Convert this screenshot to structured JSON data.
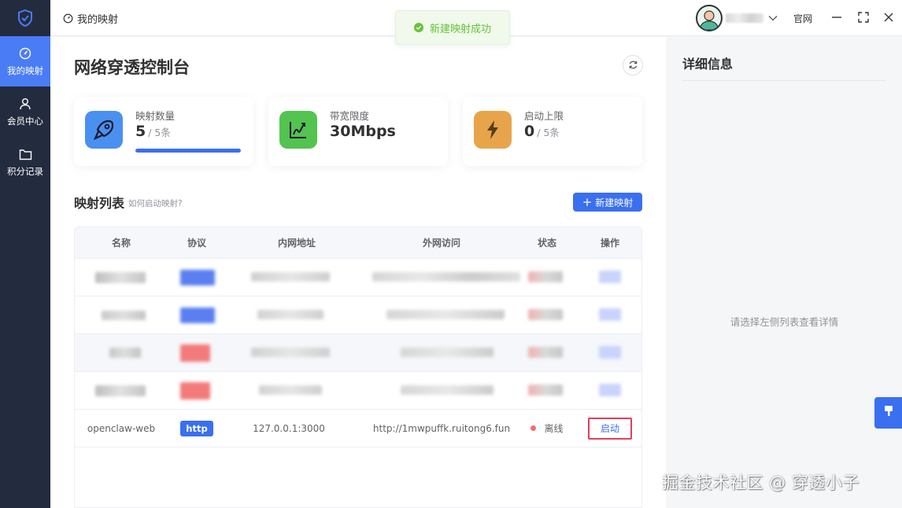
{
  "sidebar": {
    "items": [
      {
        "label": "我的映射",
        "icon": "gauge-icon",
        "active": true
      },
      {
        "label": "会员中心",
        "icon": "user-icon",
        "active": false
      },
      {
        "label": "积分记录",
        "icon": "folder-icon",
        "active": false
      }
    ]
  },
  "topbar": {
    "breadcrumb": "我的映射",
    "official_label": "官网"
  },
  "toast": {
    "text": "新建映射成功"
  },
  "main": {
    "title": "网络穿透控制台",
    "stats": [
      {
        "label": "映射数量",
        "value": "5",
        "sub": "/ 5条",
        "progress": 1.0,
        "color": "#4a90f0"
      },
      {
        "label": "带宽限度",
        "value": "30Mbps",
        "sub": "",
        "color": "#52c44f"
      },
      {
        "label": "启动上限",
        "value": "0",
        "sub": "/ 5条",
        "color": "#e8a44a"
      }
    ],
    "list_title": "映射列表",
    "list_help": "如何启动映射?",
    "new_button": "新建映射"
  },
  "table": {
    "headers": [
      "名称",
      "协议",
      "内网地址",
      "外网访问",
      "状态",
      "操作"
    ],
    "visible_row": {
      "name": "openclaw-web",
      "protocol": "http",
      "local": "127.0.0.1:3000",
      "remote": "http://1mwpuffk.ruitong6.fun",
      "status": "离线",
      "action": "启动"
    }
  },
  "detail": {
    "title": "详细信息",
    "empty": "请选择左侧列表查看详情"
  },
  "watermark": "掘金技术社区 @ 穿透小子",
  "colors": {
    "accent": "#3a6ff0",
    "sidebar": "#232b3e",
    "success": "#67c23a",
    "danger": "#f56c6c",
    "highlight": "#e63c5a"
  }
}
